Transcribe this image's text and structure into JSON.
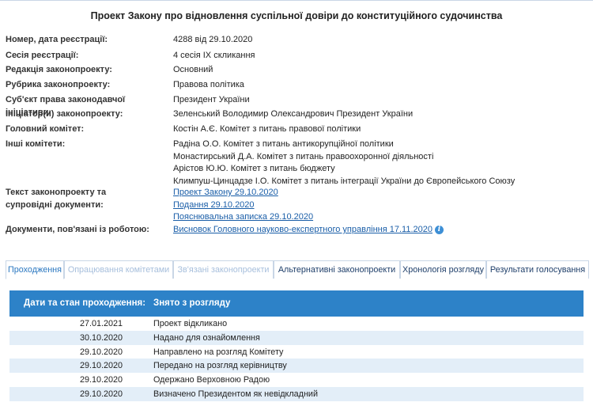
{
  "title": "Проект Закону про відновлення суспільної довіри до конституційного судочинства",
  "fields": [
    {
      "label": "Номер, дата реєстрації:",
      "values": [
        "4288 від 29.10.2020"
      ]
    },
    {
      "label": "Сесія реєстрації:",
      "values": [
        "4 сесія IX скликання"
      ]
    },
    {
      "label": "Редакція законопроекту:",
      "values": [
        "Основний"
      ]
    },
    {
      "label": "Рубрика законопроекту:",
      "values": [
        "Правова політика"
      ]
    },
    {
      "label": "Суб'єкт права законодавчої ініціативи:",
      "values": [
        "Президент України"
      ]
    },
    {
      "label": "Ініціатор(и) законопроекту:",
      "values": [
        "Зеленський Володимир Олександрович Президент України"
      ]
    },
    {
      "label": "Головний комітет:",
      "values": [
        "Костін А.Є. Комітет з питань правової політики"
      ]
    },
    {
      "label": "Інші комітети:",
      "values": [
        "Радіна О.О. Комітет з питань антикорупційної політики",
        "Монастирський Д.А. Комітет з питань правоохоронної діяльності",
        "Арістов Ю.Ю. Комітет з питань бюджету",
        "Климпуш-Цинцадзе І.О. Комітет з питань інтеграції України до Європейського Союзу"
      ]
    },
    {
      "label": "Текст законопроекту та супровідні документи:",
      "links": [
        "Проект Закону 29.10.2020",
        "Подання 29.10.2020",
        "Пояснювальна записка 29.10.2020"
      ]
    },
    {
      "label": "Документи, пов'язані із роботою:",
      "links": [
        "Висновок Головного науково-експертного управління 17.11.2020"
      ],
      "info_icon": "i"
    }
  ],
  "tabs": [
    {
      "label": "Проходження",
      "state": "active"
    },
    {
      "label": "Опрацювання комітетами",
      "state": "disabled"
    },
    {
      "label": "Зв'язані законопроекти",
      "state": "disabled"
    },
    {
      "label": "Альтернативні законопроекти",
      "state": "normal"
    },
    {
      "label": "Хронологія розгляду",
      "state": "normal"
    },
    {
      "label": "Результати голосування",
      "state": "normal"
    }
  ],
  "history": {
    "header_date": "Дати та стан проходження:",
    "header_status": "Знято з розгляду",
    "rows": [
      {
        "date": "27.01.2021",
        "status": "Проект відкликано"
      },
      {
        "date": "30.10.2020",
        "status": "Надано для ознайомлення"
      },
      {
        "date": "29.10.2020",
        "status": "Направлено на розгляд Комітету"
      },
      {
        "date": "29.10.2020",
        "status": "Передано на розгляд керівництву"
      },
      {
        "date": "29.10.2020",
        "status": "Одержано Верховною Радою"
      },
      {
        "date": "29.10.2020",
        "status": "Визначено Президентом як невідкладний"
      }
    ]
  },
  "colors": {
    "accent": "#2d82c8",
    "link": "#1a5ea8",
    "row_alt": "#e3eef8",
    "tab_border": "#c9d6e6"
  }
}
